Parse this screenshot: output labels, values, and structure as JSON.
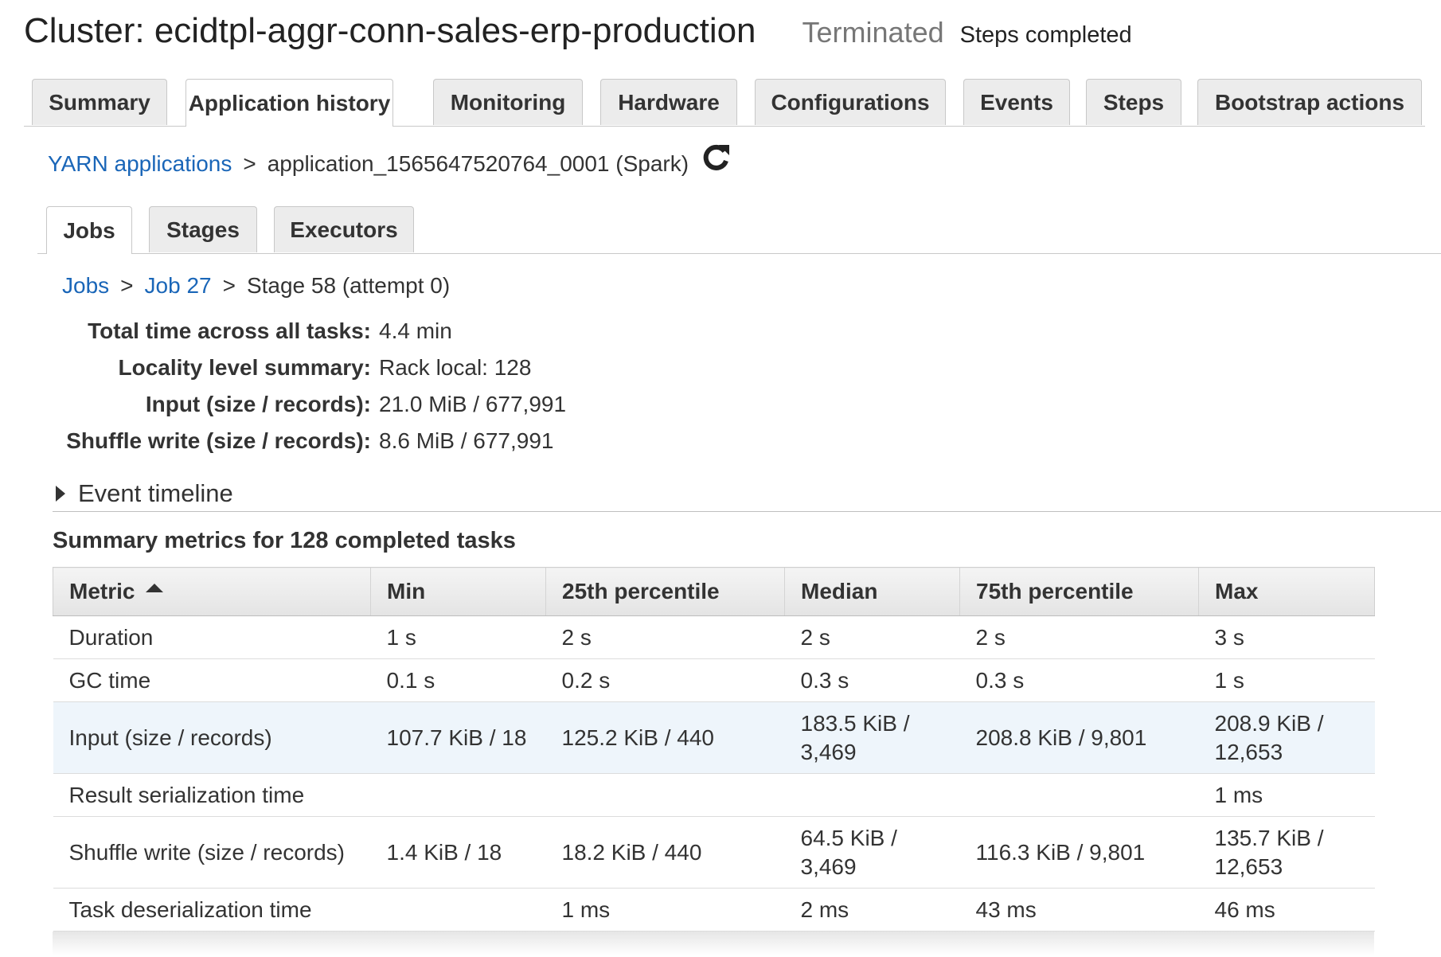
{
  "header": {
    "cluster_title": "Cluster: ecidtpl-aggr-conn-sales-erp-production",
    "status": "Terminated",
    "status_detail": "Steps completed"
  },
  "main_tabs": [
    {
      "label": "Summary",
      "active": false
    },
    {
      "label": "Application history",
      "active": true
    },
    {
      "label": "Monitoring",
      "active": false
    },
    {
      "label": "Hardware",
      "active": false
    },
    {
      "label": "Configurations",
      "active": false
    },
    {
      "label": "Events",
      "active": false
    },
    {
      "label": "Steps",
      "active": false
    },
    {
      "label": "Bootstrap actions",
      "active": false
    }
  ],
  "app_breadcrumb": {
    "link": "YARN applications",
    "separator": ">",
    "current": "application_1565647520764_0001 (Spark)",
    "refresh_icon": "refresh-icon"
  },
  "sub_tabs": [
    {
      "label": "Jobs",
      "active": true
    },
    {
      "label": "Stages",
      "active": false
    },
    {
      "label": "Executors",
      "active": false
    }
  ],
  "stage_breadcrumb": {
    "jobs_link": "Jobs",
    "job_link": "Job 27",
    "separator": ">",
    "current": "Stage 58 (attempt 0)"
  },
  "stats": [
    {
      "label": "Total time across all tasks:",
      "value": "4.4 min"
    },
    {
      "label": "Locality level summary:",
      "value": "Rack local: 128"
    },
    {
      "label": "Input (size / records):",
      "value": "21.0 MiB / 677,991"
    },
    {
      "label": "Shuffle write (size / records):",
      "value": "8.6 MiB / 677,991"
    }
  ],
  "event_timeline": {
    "label": "Event timeline",
    "icon": "triangle-right-icon"
  },
  "summary_metrics": {
    "title": "Summary metrics for 128 completed tasks",
    "columns": [
      "Metric",
      "Min",
      "25th percentile",
      "Median",
      "75th percentile",
      "Max"
    ],
    "sorted_column": "Metric",
    "sort_direction": "ascending",
    "rows": [
      [
        "Duration",
        "1 s",
        "2 s",
        "2 s",
        "2 s",
        "3 s"
      ],
      [
        "GC time",
        "0.1 s",
        "0.2 s",
        "0.3 s",
        "0.3 s",
        "1 s"
      ],
      [
        "Input (size / records)",
        "107.7 KiB / 18",
        "125.2 KiB / 440",
        "183.5 KiB / 3,469",
        "208.8 KiB / 9,801",
        "208.9 KiB / 12,653"
      ],
      [
        "Result serialization time",
        "",
        "",
        "",
        "",
        "1 ms"
      ],
      [
        "Shuffle write (size / records)",
        "1.4 KiB / 18",
        "18.2 KiB / 440",
        "64.5 KiB / 3,469",
        "116.3 KiB / 9,801",
        "135.7 KiB / 12,653"
      ],
      [
        "Task deserialization time",
        "",
        "1 ms",
        "2 ms",
        "43 ms",
        "46 ms"
      ]
    ],
    "highlighted_row": 2
  },
  "colors": {
    "link": "#1a66b8",
    "highlight_row": "#eef5fb",
    "tab_bg": "#ececec"
  }
}
